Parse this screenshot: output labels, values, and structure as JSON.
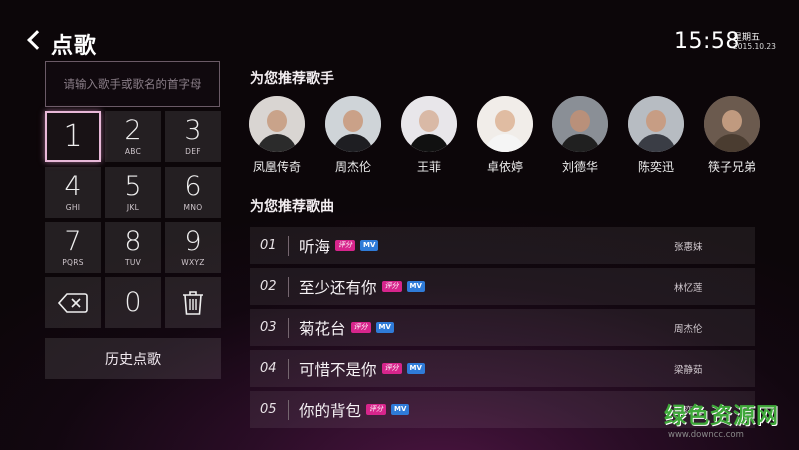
{
  "header": {
    "title": "点歌",
    "time": "15:58",
    "weekday": "星期五",
    "date": "2015.10.23"
  },
  "search": {
    "placeholder": "请输入歌手或歌名的首字母"
  },
  "keypad": {
    "keys": [
      {
        "num": "1",
        "sub": ""
      },
      {
        "num": "2",
        "sub": "ABC"
      },
      {
        "num": "3",
        "sub": "DEF"
      },
      {
        "num": "4",
        "sub": "GHI"
      },
      {
        "num": "5",
        "sub": "JKL"
      },
      {
        "num": "6",
        "sub": "MNO"
      },
      {
        "num": "7",
        "sub": "PQRS"
      },
      {
        "num": "8",
        "sub": "TUV"
      },
      {
        "num": "9",
        "sub": "WXYZ"
      },
      {
        "num": "0",
        "sub": ""
      }
    ],
    "backspace_icon": "backspace-icon",
    "delete_icon": "trash-icon",
    "history_label": "历史点歌"
  },
  "singers": {
    "title": "为您推荐歌手",
    "items": [
      {
        "name": "凤凰传奇",
        "bg": "#d9d5d2",
        "skin": "#c9a38a",
        "cloth": "#2b2b2b"
      },
      {
        "name": "周杰伦",
        "bg": "#cfd4d8",
        "skin": "#caa188",
        "cloth": "#1e1e22"
      },
      {
        "name": "王菲",
        "bg": "#e8e6ea",
        "skin": "#d9b9a6",
        "cloth": "#111"
      },
      {
        "name": "卓依婷",
        "bg": "#f1ede9",
        "skin": "#e0bca2",
        "cloth": "#f5f5f5"
      },
      {
        "name": "刘德华",
        "bg": "#8a8f96",
        "skin": "#b9907a",
        "cloth": "#202020"
      },
      {
        "name": "陈奕迅",
        "bg": "#b7bcc2",
        "skin": "#c79d84",
        "cloth": "#3a3d45"
      },
      {
        "name": "筷子兄弟",
        "bg": "#6b5a4e",
        "skin": "#c09a7f",
        "cloth": "#4a3c30"
      }
    ]
  },
  "songs": {
    "title": "为您推荐歌曲",
    "tag_score": "评分",
    "tag_mv": "MV",
    "items": [
      {
        "index": "01",
        "name": "听海",
        "artist": "张惠妹"
      },
      {
        "index": "02",
        "name": "至少还有你",
        "artist": "林忆莲"
      },
      {
        "index": "03",
        "name": "菊花台",
        "artist": "周杰伦"
      },
      {
        "index": "04",
        "name": "可惜不是你",
        "artist": "梁静茹"
      },
      {
        "index": "05",
        "name": "你的背包",
        "artist": "陈奕迅"
      }
    ]
  },
  "watermark": {
    "main": "绿色资源网",
    "sub": "www.downcc.com"
  }
}
